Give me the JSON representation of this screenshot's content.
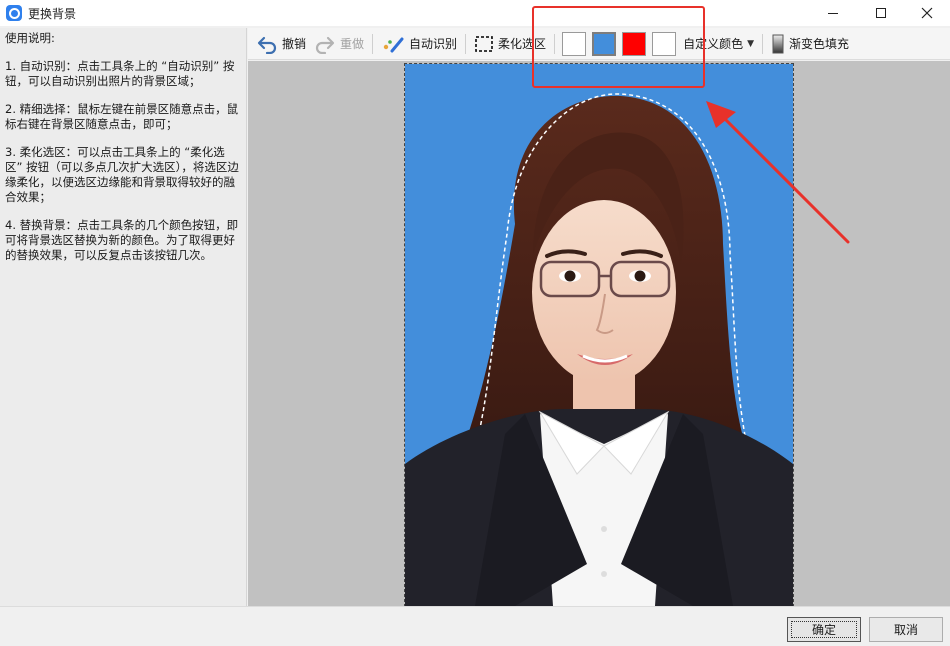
{
  "window": {
    "title": "更换背景"
  },
  "sidebar": {
    "heading": "使用说明:",
    "steps": [
      "1. 自动识别：点击工具条上的 “自动识别” 按钮，可以自动识别出照片的背景区域；",
      "2. 精细选择：鼠标左键在前景区随意点击，鼠标右键在背景区随意点击，即可；",
      "3. 柔化选区：可以点击工具条上的 “柔化选区” 按钮（可以多点几次扩大选区），将选区边缘柔化，以便选区边缘能和背景取得较好的融合效果；",
      "4. 替换背景：点击工具条的几个颜色按钮，即可将背景选区替换为新的颜色。为了取得更好的替换效果，可以反复点击该按钮几次。"
    ]
  },
  "toolbar": {
    "undo_label": "撤销",
    "redo_label": "重做",
    "auto_detect_label": "自动识别",
    "feather_label": "柔化选区",
    "swatches": [
      {
        "name": "white",
        "color": "#FFFFFF"
      },
      {
        "name": "blue",
        "color": "#438EDB"
      },
      {
        "name": "red",
        "color": "#FF0000"
      },
      {
        "name": "custom",
        "color": "#FFFFFF"
      }
    ],
    "custom_color_label": "自定义颜色",
    "gradient_fill_label": "渐变色填充"
  },
  "photo": {
    "background_color": "#438EDB"
  },
  "annotation": {
    "color": "#E8312A"
  },
  "footer": {
    "ok_label": "确定",
    "cancel_label": "取消"
  }
}
